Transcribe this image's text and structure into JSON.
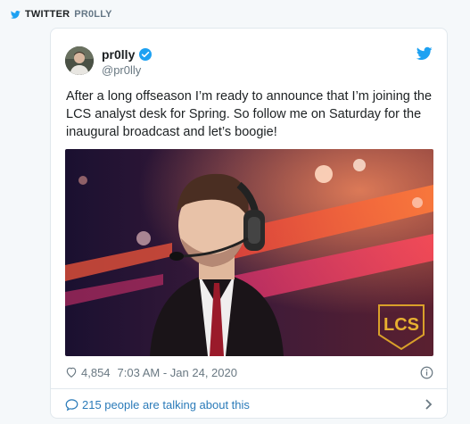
{
  "source": {
    "network": "TWITTER",
    "account": "PR0LLY"
  },
  "tweet": {
    "display_name": "pr0lly",
    "handle": "@pr0lly",
    "text": "After a long offseason I’m ready to announce that I’m joining the LCS analyst desk for Spring. So follow me on Saturday for the inaugural broadcast and let’s boogie!",
    "likes": "4,854",
    "timestamp": "7:03 AM - Jan 24, 2020",
    "talking": "215 people are talking about this",
    "media_badge": "LCS"
  },
  "colors": {
    "twitter_blue": "#1da1f2",
    "link": "#2b7bb9",
    "muted": "#697882"
  },
  "icons": [
    "twitter-bird-icon",
    "verified-badge-icon",
    "heart-icon",
    "info-icon",
    "chat-bubble-icon",
    "chevron-right-icon"
  ]
}
